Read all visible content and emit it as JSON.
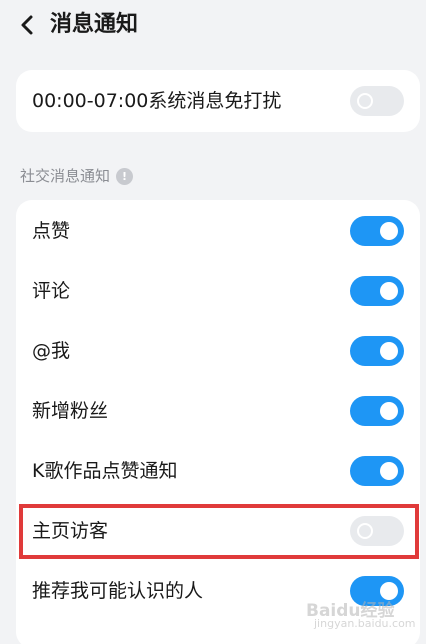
{
  "header": {
    "title": "消息通知",
    "back_icon": "chevron-left-icon"
  },
  "dnd": {
    "label": "00:00-07:00系统消息免打扰",
    "enabled": false
  },
  "social_section": {
    "title": "社交消息通知",
    "info_icon": "info-icon",
    "info_glyph": "!"
  },
  "social_items": [
    {
      "label": "点赞",
      "enabled": true
    },
    {
      "label": "评论",
      "enabled": true
    },
    {
      "label": "@我",
      "enabled": true
    },
    {
      "label": "新增粉丝",
      "enabled": true
    },
    {
      "label": "K歌作品点赞通知",
      "enabled": true
    },
    {
      "label": "主页访客",
      "enabled": false
    },
    {
      "label": "推荐我可能认识的人",
      "enabled": true
    }
  ],
  "watermark": {
    "text": "Baidu经验",
    "sub": "jingyan.baidu.com"
  },
  "colors": {
    "toggle_on": "#1e96f5",
    "toggle_off": "#e8eaed",
    "highlight": "#e03a3a",
    "background": "#f2f3f5"
  }
}
